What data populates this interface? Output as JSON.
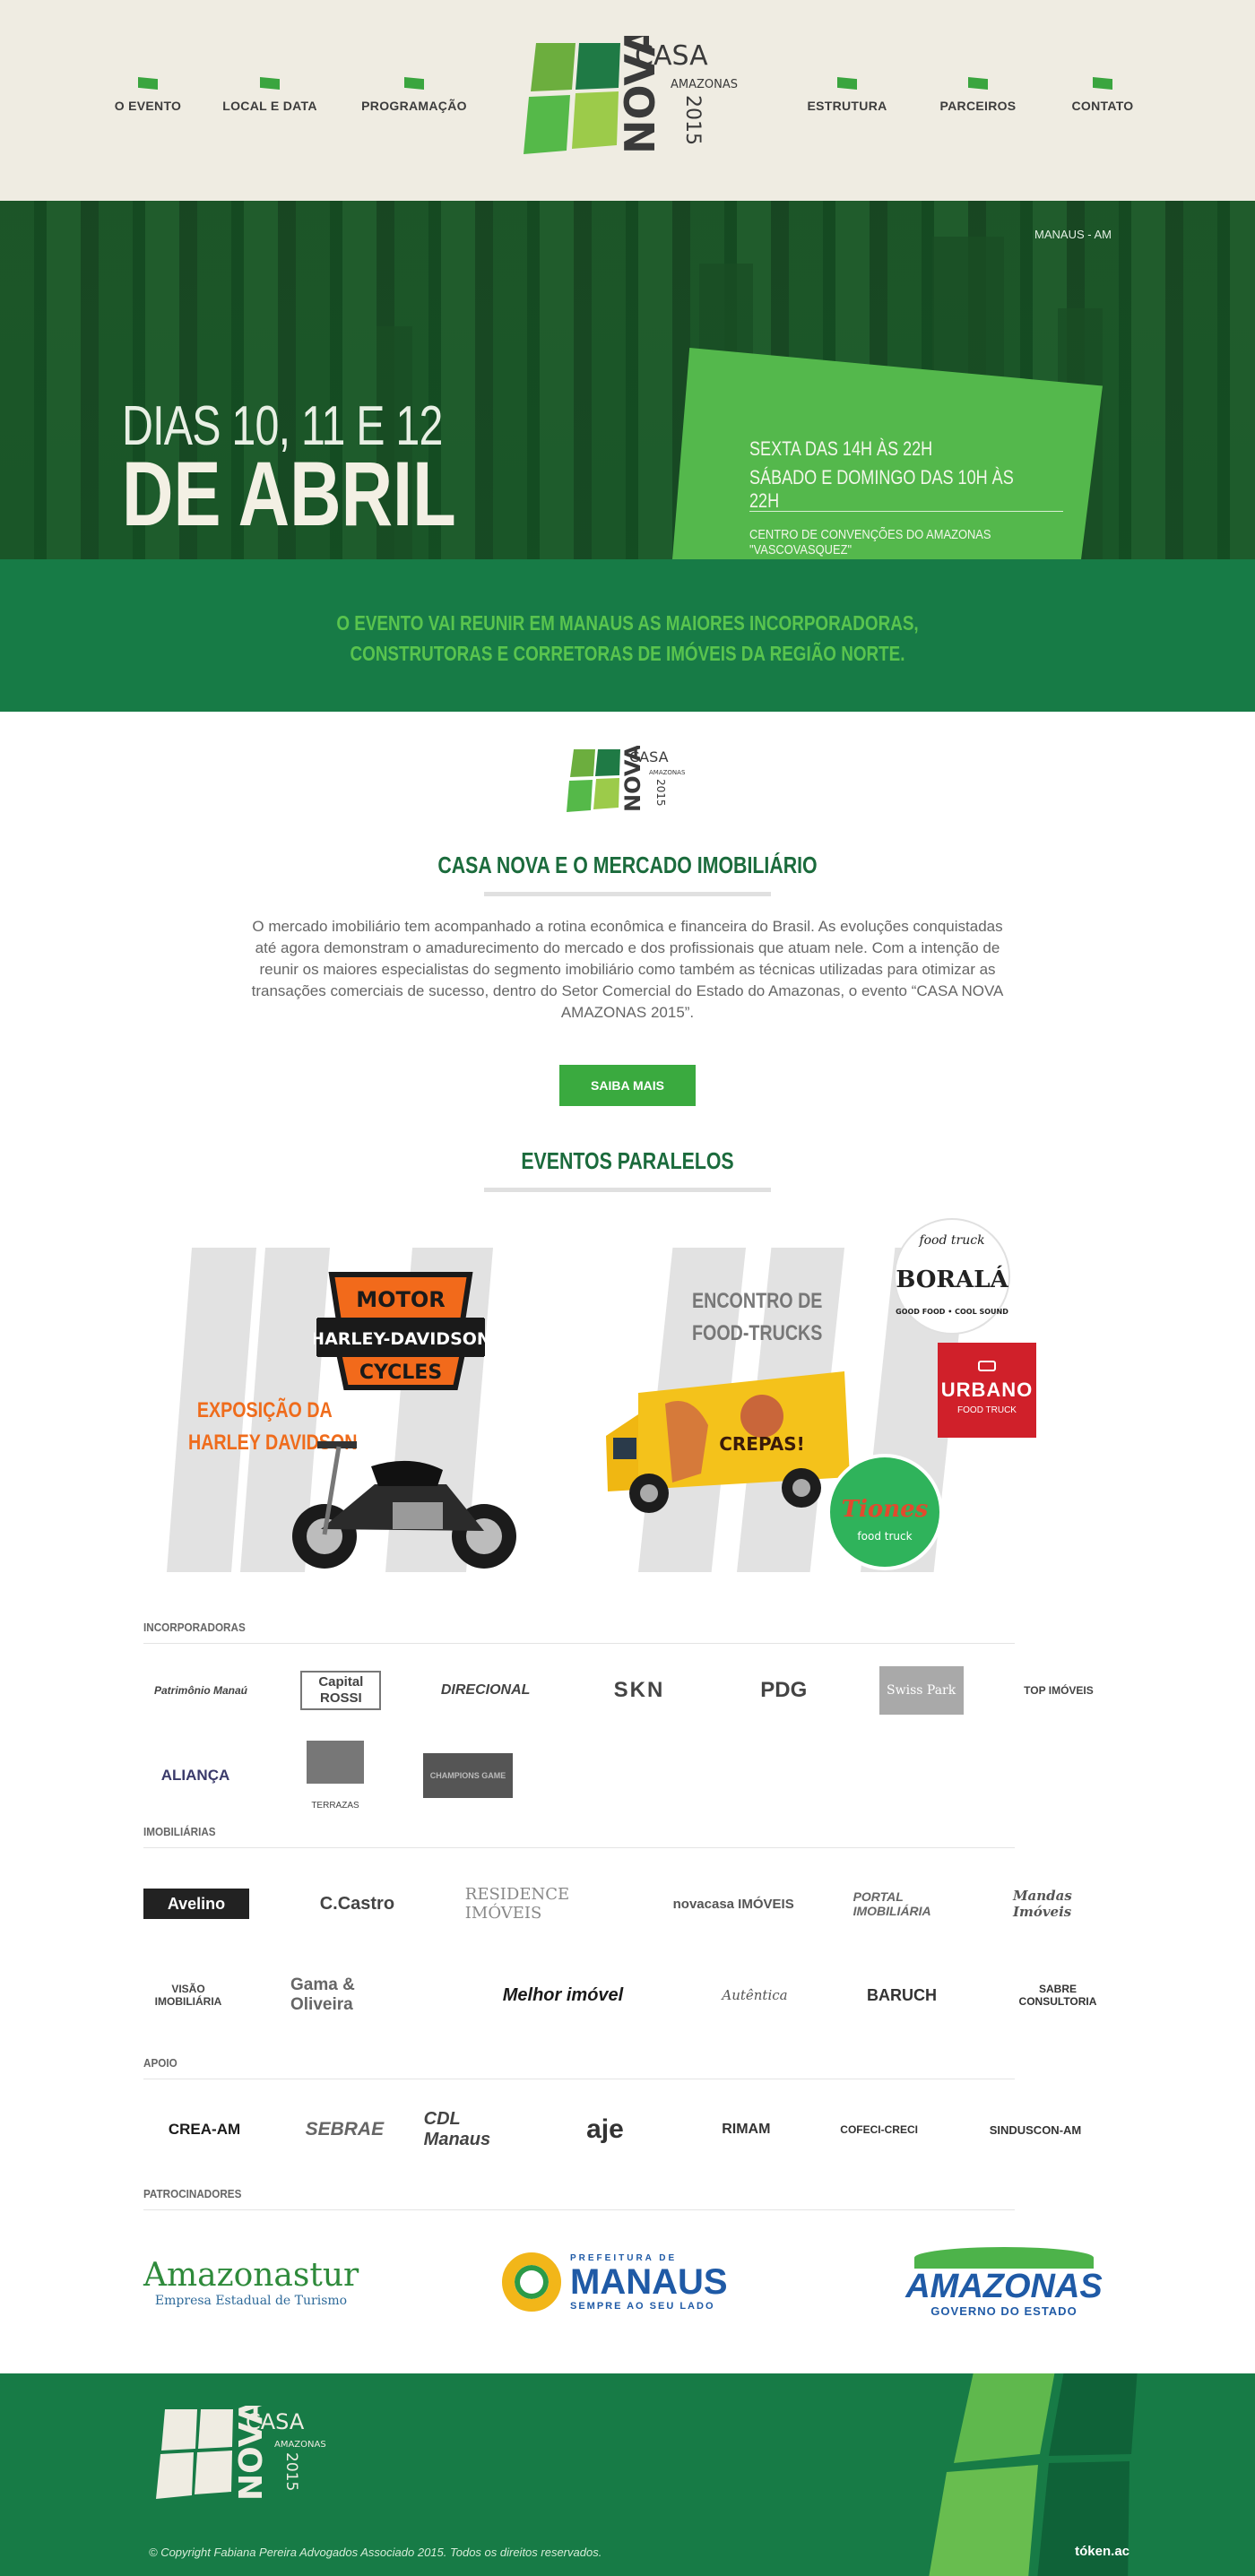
{
  "nav": {
    "left": [
      "O EVENTO",
      "LOCAL E DATA",
      "PROGRAMAÇÃO"
    ],
    "right": [
      "ESTRUTURA",
      "PARCEIROS",
      "CONTATO"
    ]
  },
  "logo": {
    "casa": "CASA",
    "nova": "NOVA",
    "amazonas": "AMAZONAS",
    "year": "2015"
  },
  "hero": {
    "city": "MANAUS - AM",
    "dias": "DIAS 10, 11 E 12",
    "abril": "DE ABRIL",
    "schedule1": "SEXTA DAS 14H ÀS 22H",
    "schedule2": "SÁBADO E DOMINGO DAS 10H ÀS 22H",
    "venue": "CENTRO DE CONVENÇÕES DO AMAZONAS \"VASCOVASQUEZ\""
  },
  "band": {
    "line1": "O EVENTO VAI REUNIR EM MANAUS AS MAIORES INCORPORADORAS,",
    "line2": "CONSTRUTORAS E CORRETORAS DE IMÓVEIS DA REGIÃO NORTE."
  },
  "about": {
    "title": "CASA NOVA E O MERCADO IMOBILIÁRIO",
    "text": "O mercado imobiliário tem acompanhado a rotina econômica e financeira do Brasil. As evoluções conquistadas até agora demonstram o amadurecimento do mercado e dos profissionais que atuam nele. Com a intenção de reunir os maiores especialistas do segmento imobiliário como também as técnicas utilizadas para otimizar as transações comerciais de sucesso, dentro do Setor Comercial do Estado do Amazonas, o evento “CASA NOVA AMAZONAS 2015”.",
    "button": "SAIBA MAIS"
  },
  "events": {
    "title": "EVENTOS PARALELOS",
    "harley_title": "EXPOSIÇÃO DA",
    "harley_title2": "HARLEY DAVIDSON",
    "harley_logo_top": "MOTOR",
    "harley_logo_mid": "HARLEY-DAVIDSON",
    "harley_logo_bot": "CYCLES",
    "food_title": "ENCONTRO DE",
    "food_title2": "FOOD-TRUCKS",
    "borala_top": "food truck",
    "borala": "BORALÁ",
    "borala_bottom": "GOOD FOOD • COOL SOUND",
    "urbano": "URBANO",
    "urbano_sub": "FOOD TRUCK",
    "tiones": "Tiones",
    "tiones_sub": "food truck",
    "truck_text": "CREPAS!"
  },
  "groups": {
    "incorporadoras": {
      "title": "INCORPORADORAS",
      "row1": [
        "Patrimônio Manaú",
        "Capital ROSSI",
        "DIRECIONAL",
        "SKN",
        "PDG",
        "Swiss Park",
        "TOP IMÓVEIS"
      ],
      "row2": [
        "ALIANÇA",
        "TERRAZAS",
        "CHAMPIONS GAME"
      ]
    },
    "imobiliarias": {
      "title": "IMOBILIÁRIAS",
      "row1": [
        "Avelino",
        "C.Castro",
        "RESIDENCE IMÓVEIS",
        "novacasa IMÓVEIS",
        "PORTAL IMOBILIÁRIA",
        "Mandas Imóveis"
      ],
      "row2": [
        "VISÃO IMOBILIÁRIA",
        "Gama & Oliveira",
        "Melhor imóvel",
        "Autêntica",
        "BARUCH",
        "SABRE CONSULTORIA"
      ]
    },
    "apoio": {
      "title": "APOIO",
      "row1": [
        "CREA-AM",
        "SEBRAE",
        "CDL Manaus",
        "aje",
        "RIMAM",
        "COFECI-CRECI",
        "SINDUSCON-AM"
      ]
    },
    "patrocinadores": {
      "title": "PATROCINADORES",
      "row1": [
        "Amazonastur",
        "MANAUS",
        "AMAZONAS"
      ],
      "sub": [
        "Empresa Estadual de Turismo",
        "SEMPRE AO SEU LADO",
        "GOVERNO DO ESTADO"
      ],
      "pref": "PREFEITURA DE"
    }
  },
  "footer": {
    "copyright": "© Copyright Fabiana Pereira Advogados Associado 2015. Todos os direitos reservados.",
    "credit": "tóken.ac"
  },
  "colors": {
    "green_dark": "#177b46",
    "green_light": "#54b84c",
    "cream": "#efece2"
  }
}
